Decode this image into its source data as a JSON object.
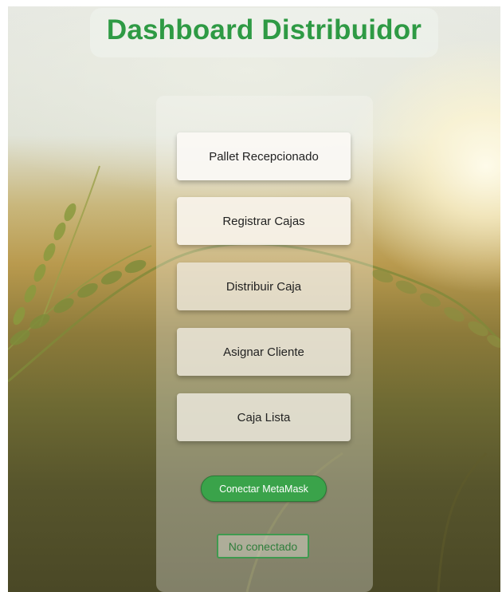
{
  "header": {
    "title": "Dashboard Distribuidor"
  },
  "actions": [
    {
      "label": "Pallet Recepcionado"
    },
    {
      "label": "Registrar Cajas"
    },
    {
      "label": "Distribuir Caja"
    },
    {
      "label": "Asignar Cliente"
    },
    {
      "label": "Caja Lista"
    }
  ],
  "wallet": {
    "connect_label": "Conectar MetaMask",
    "status": "No conectado"
  },
  "colors": {
    "title": "#2e9a44",
    "connect_button": "#3aa34a",
    "status_border": "#3f9a4f"
  },
  "background": {
    "image": "wheat-field-photo"
  }
}
